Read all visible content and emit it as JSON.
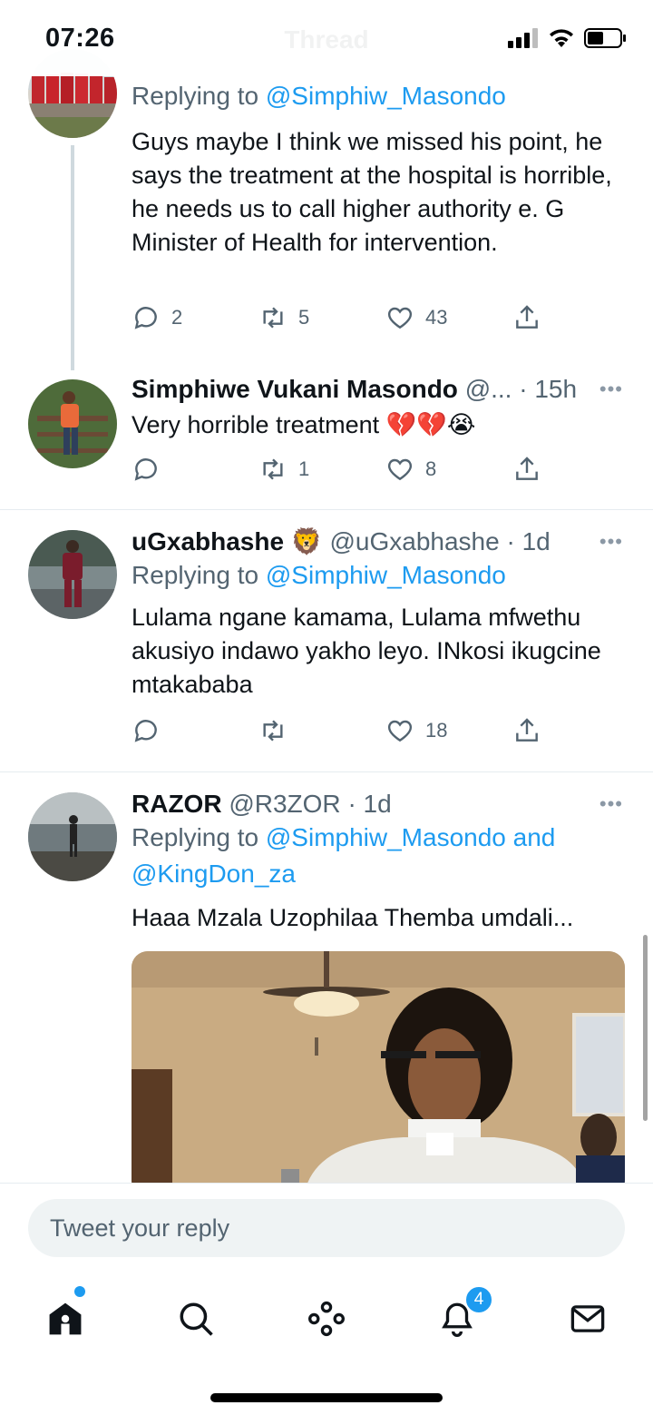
{
  "status_bar": {
    "time": "07:26",
    "faded_title": "Thread"
  },
  "tweets": [
    {
      "replying_prefix": "Replying to ",
      "replying_to": "@Simphiw_Masondo",
      "text": "Guys maybe I think we missed his point, he says the treatment at the hospital is horrible, he needs us to call higher authority e. G Minister of Health for intervention.",
      "replies": "2",
      "retweets": "5",
      "likes": "43",
      "avatar_desc": "red buses"
    },
    {
      "name": "Simphiwe Vukani Masondo",
      "handle": "@...",
      "time": "· 15h",
      "text": "Very horrible treatment 💔💔😭",
      "replies": "",
      "retweets": "1",
      "likes": "8"
    },
    {
      "name": "uGxabhashe 🦁",
      "handle": "@uGxabhashe",
      "time": "· 1d",
      "replying_prefix": "Replying to ",
      "replying_to": "@Simphiw_Masondo",
      "text": "Lulama ngane kamama, Lulama mfwethu akusiyo indawo yakho leyo. INkosi ikugcine mtakababa",
      "replies": "",
      "retweets": "",
      "likes": "18"
    },
    {
      "name": "RAZOR",
      "handle": "@R3ZOR",
      "time": "· 1d",
      "replying_prefix": "Replying to ",
      "replying_to": "@Simphiw_Masondo and",
      "replying_to_2": "@KingDon_za",
      "text": "Haaa Mzala Uzophilaa Themba umdali..."
    }
  ],
  "reply_bar": {
    "placeholder": "Tweet your reply"
  },
  "tab_bar": {
    "notifications_badge": "4"
  },
  "colors": {
    "accent": "#1d9bf0",
    "text": "#0f1419",
    "secondary": "#536471",
    "heart_emoji": "#d62839"
  }
}
